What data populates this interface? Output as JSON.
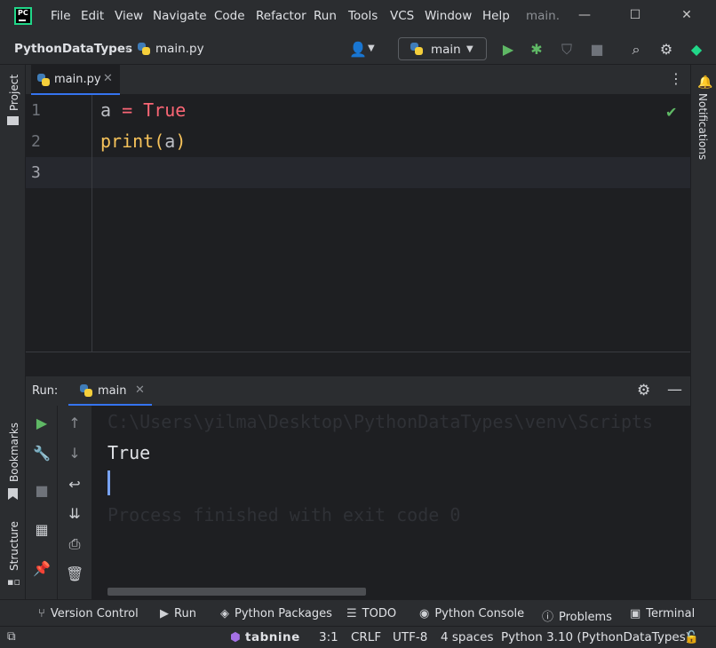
{
  "menu": {
    "logo_text": "PC",
    "items": [
      "File",
      "Edit",
      "View",
      "Navigate",
      "Code",
      "Refactor",
      "Run",
      "Tools",
      "VCS",
      "Window",
      "Help"
    ],
    "title": "main.",
    "minimize": "—",
    "maximize": "☐",
    "close": "✕"
  },
  "nav": {
    "project": "PythonDataTypes",
    "separator": "›",
    "file": "main.py",
    "run_config": "main"
  },
  "side": {
    "left_top": "Project",
    "left_bookmarks": "Bookmarks",
    "left_structure": "Structure",
    "right": "Notifications"
  },
  "editor": {
    "tab_label": "main.py",
    "line_numbers": [
      "1",
      "2",
      "3"
    ],
    "line1": {
      "var": "a",
      "op": " = ",
      "value": "True"
    },
    "line2": {
      "fn": "print",
      "open": "(",
      "arg": "a",
      "close": ")"
    }
  },
  "run": {
    "label": "Run:",
    "tab_label": "main",
    "console": {
      "command": "C:\\Users\\yilma\\Desktop\\PythonDataTypes\\venv\\Scripts",
      "output": "True",
      "finished": "Process finished with exit code 0"
    }
  },
  "bottom_tools": [
    "Version Control",
    "Run",
    "Python Packages",
    "TODO",
    "Python Console",
    "Problems",
    "Terminal"
  ],
  "status": {
    "plugin": "tabnine",
    "position": "3:1",
    "line_ending": "CRLF",
    "encoding": "UTF-8",
    "indent": "4 spaces",
    "interpreter": "Python 3.10 (PythonDataTypes)"
  },
  "colors": {
    "accent": "#3574f0",
    "run_green": "#5fb865",
    "keyword_red": "#fa6675",
    "function_orange": "#f7c35b"
  }
}
